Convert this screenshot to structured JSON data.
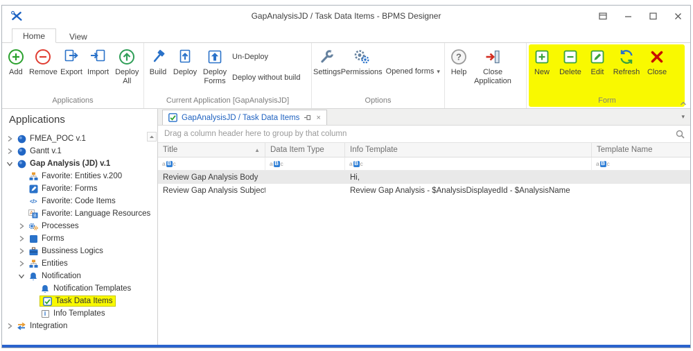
{
  "colors": {
    "accent_blue": "#1f62c0",
    "highlight_yellow": "#f9f900",
    "selected_row": "#e9e9e9",
    "alert_red": "#d22b1f",
    "ok_green": "#2ba12e"
  },
  "window": {
    "title": "GapAnalysisJD / Task Data Items - BPMS Designer"
  },
  "ribbon": {
    "tabs": [
      {
        "label": "Home"
      },
      {
        "label": "View"
      }
    ],
    "groups": {
      "applications": {
        "label": "Applications",
        "buttons": [
          {
            "label": "Add"
          },
          {
            "label": "Remove"
          },
          {
            "label": "Export"
          },
          {
            "label": "Import"
          },
          {
            "label": "Deploy All"
          }
        ]
      },
      "current_application": {
        "label": "Current Application [GapAnalysisJD]",
        "buttons": [
          {
            "label": "Build"
          },
          {
            "label": "Deploy"
          },
          {
            "label": "Deploy Forms"
          }
        ],
        "links": [
          {
            "label": "Un-Deploy"
          },
          {
            "label": "Deploy without build"
          }
        ]
      },
      "options": {
        "label": "Options",
        "buttons": [
          {
            "label": "Settings"
          },
          {
            "label": "Permissions"
          }
        ],
        "dropdown_label": "Opened forms"
      },
      "help": {
        "label": "",
        "buttons": [
          {
            "label": "Help"
          },
          {
            "label": "Close Application"
          }
        ]
      },
      "form": {
        "label": "Form",
        "highlighted": true,
        "buttons": [
          {
            "label": "New"
          },
          {
            "label": "Delete"
          },
          {
            "label": "Edit"
          },
          {
            "label": "Refresh"
          },
          {
            "label": "Close"
          }
        ]
      }
    }
  },
  "sidebar": {
    "title": "Applications",
    "tree": [
      {
        "label": "FMEA_POC v.1",
        "level": 0,
        "expander": "collapsed",
        "icon": "application-icon"
      },
      {
        "label": "Gantt v.1",
        "level": 0,
        "expander": "collapsed",
        "icon": "application-icon"
      },
      {
        "label": "Gap Analysis (JD) v.1",
        "level": 0,
        "expander": "expanded",
        "icon": "application-icon",
        "bold": true
      },
      {
        "label": "Favorite: Entities v.200",
        "level": 1,
        "icon": "entities-icon"
      },
      {
        "label": "Favorite: Forms",
        "level": 1,
        "icon": "form-pencil-icon"
      },
      {
        "label": "Favorite: Code Items",
        "level": 1,
        "icon": "code-icon"
      },
      {
        "label": "Favorite: Language Resources",
        "level": 1,
        "icon": "language-icon"
      },
      {
        "label": "Processes",
        "level": 1,
        "expander": "collapsed",
        "icon": "gears-icon"
      },
      {
        "label": "Forms",
        "level": 1,
        "expander": "collapsed",
        "icon": "form-square-icon"
      },
      {
        "label": "Bussiness Logics",
        "level": 1,
        "expander": "collapsed",
        "icon": "briefcase-icon"
      },
      {
        "label": "Entities",
        "level": 1,
        "expander": "collapsed",
        "icon": "entities-icon"
      },
      {
        "label": "Notification",
        "level": 1,
        "expander": "expanded",
        "icon": "bell-icon"
      },
      {
        "label": "Notification Templates",
        "level": 2,
        "icon": "bell-icon"
      },
      {
        "label": "Task Data Items",
        "level": 2,
        "icon": "checkbox-icon",
        "highlighted": true
      },
      {
        "label": "Info Templates",
        "level": 2,
        "icon": "info-icon"
      },
      {
        "label": "Integration",
        "level": 0,
        "expander": "collapsed",
        "icon": "integration-icon"
      }
    ]
  },
  "main": {
    "tab_label": "GapAnalysisJD / Task Data Items",
    "group_hint": "Drag a column header here to group by that column",
    "table": {
      "columns": [
        {
          "label": "Title"
        },
        {
          "label": "Data Item Type"
        },
        {
          "label": "Info Template"
        },
        {
          "label": "Template Name"
        }
      ],
      "sorted_column": "Title",
      "sort_direction": "ascending",
      "rows": [
        {
          "selected": true,
          "cells": [
            "Review Gap Analysis Body",
            "",
            "Hi,",
            ""
          ]
        },
        {
          "selected": false,
          "cells": [
            "Review Gap Analysis Subject",
            "",
            "Review Gap Analysis - $AnalysisDisplayedId - $AnalysisName",
            ""
          ]
        }
      ]
    }
  },
  "icons": {
    "sort_asc": "▲",
    "caret_down": "▾",
    "tab_close": "×",
    "filter_a": "a",
    "filter_b": "B",
    "filter_c": "c",
    "help_glyph": "?",
    "code_glyph": "</>",
    "info_glyph": "i",
    "lang_a": "A",
    "lang_b": "B"
  }
}
